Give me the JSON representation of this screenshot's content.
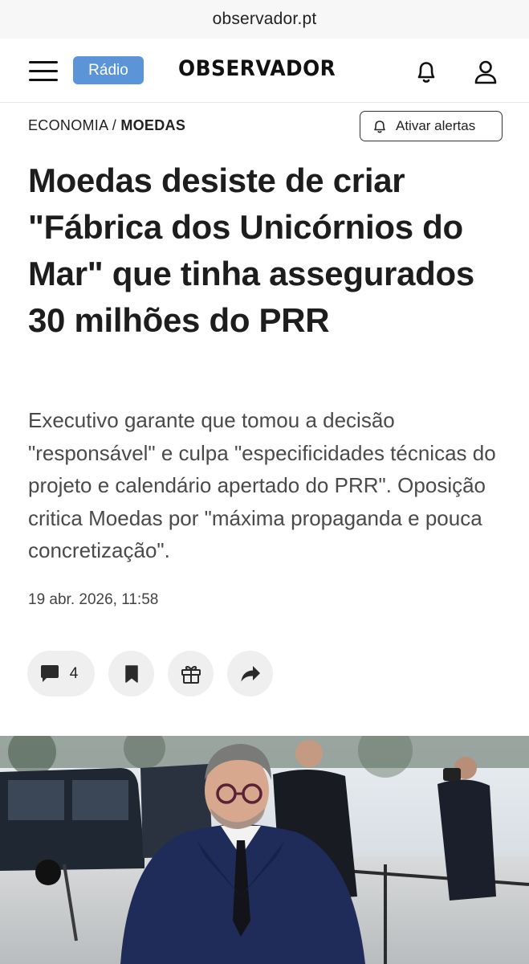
{
  "browser": {
    "url": "observador.pt"
  },
  "header": {
    "radio_label": "Rádio",
    "logo_text": "OBSERVADOR",
    "accent_color": "#5b95d8"
  },
  "breadcrumb": {
    "section": "ECONOMIA",
    "separator": " / ",
    "topic": "MOEDAS"
  },
  "alert_button": {
    "label": "Ativar alertas",
    "icon": "bell-icon"
  },
  "article": {
    "title": "Moedas desiste de criar \"Fábrica dos Unicórnios do Mar\" que tinha assegurados 30 milhões do PRR",
    "lead": "Executivo garante que tomou a decisão \"responsável\" e culpa \"especificidades técnicas do projeto e calendário apertado do PRR\". Oposição critica Moedas por \"máxima propaganda e pouca concretização\".",
    "date": "19 abr. 2026, 11:58"
  },
  "actions": {
    "comments_count": "4",
    "icons": [
      "comment-icon",
      "bookmark-icon",
      "gift-icon",
      "share-icon"
    ]
  }
}
